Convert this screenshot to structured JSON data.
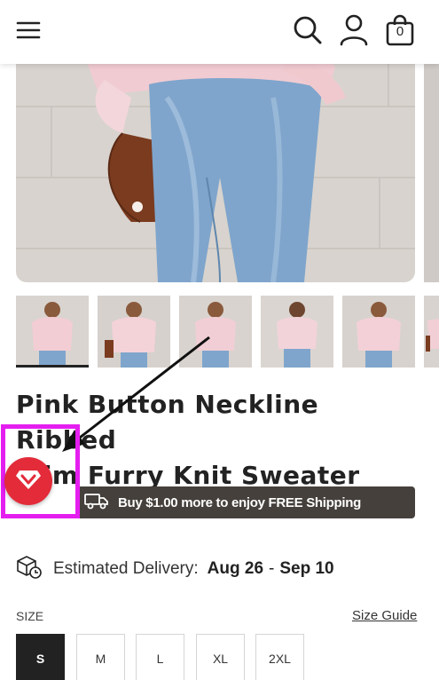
{
  "header": {
    "menu_icon": "hamburger-menu-icon",
    "search_icon": "search-icon",
    "account_icon": "account-icon",
    "cart_icon": "shopping-bag-icon",
    "cart_count": "0"
  },
  "product": {
    "title_line1": "Pink Button Neckline Ribbed",
    "title_line2": "Trim Furry Knit Sweater",
    "thumbnail_count": 5
  },
  "shipping_banner": {
    "icon": "delivery-truck-icon",
    "text": "Buy $1.00 more to enjoy FREE Shipping",
    "background_color": "#45403c"
  },
  "floating_button": {
    "icon": "diamond-gift-icon",
    "color": "#e32b3a"
  },
  "delivery": {
    "icon": "package-clock-icon",
    "label": "Estimated Delivery",
    "colon": ":",
    "start": "Aug 26",
    "separator": "-",
    "end": "Sep 10"
  },
  "size": {
    "label": "SIZE",
    "guide_link": "Size Guide",
    "options": [
      "S",
      "M",
      "L",
      "XL",
      "2XL"
    ],
    "selected": "S"
  },
  "annotation": {
    "highlight_color": "#e51ef0"
  }
}
